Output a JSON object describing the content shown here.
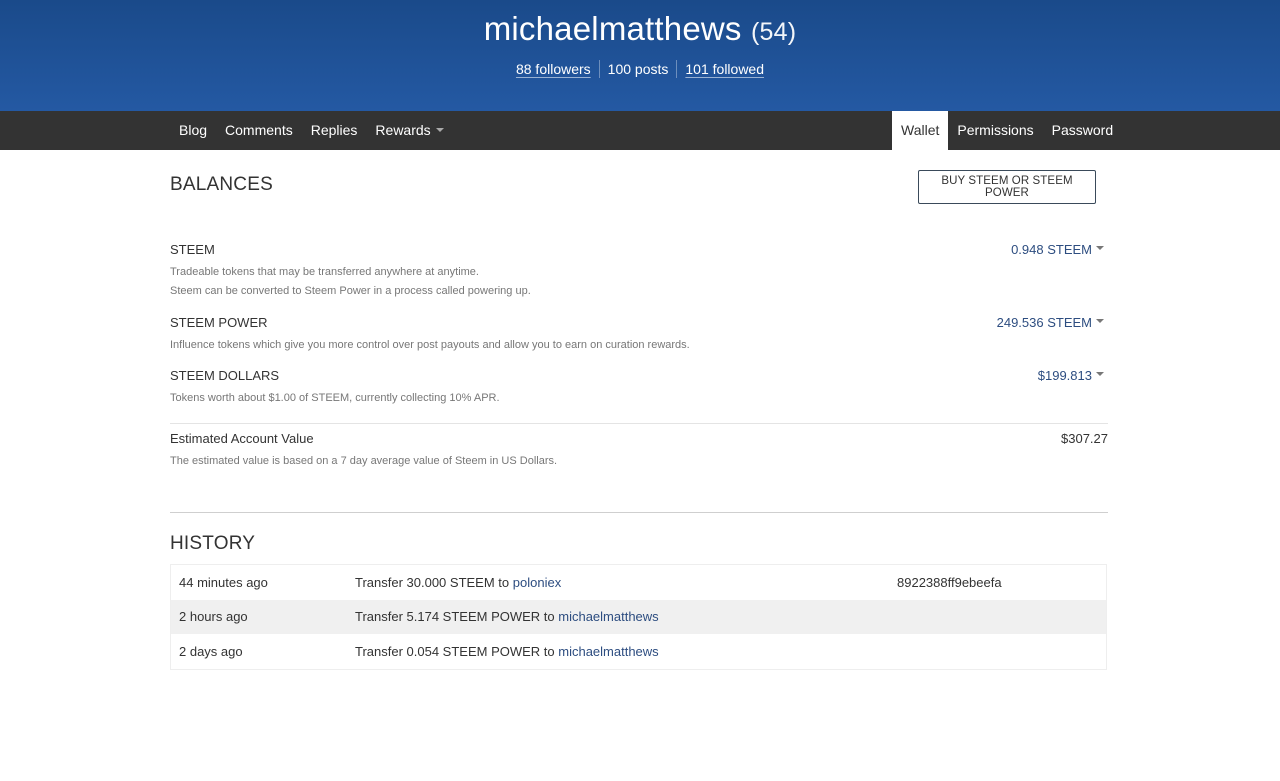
{
  "profile": {
    "username": "michaelmatthews",
    "reputation": "(54)",
    "followers": "88 followers",
    "posts": "100 posts",
    "followed": "101 followed"
  },
  "nav": {
    "left": [
      "Blog",
      "Comments",
      "Replies",
      "Rewards"
    ],
    "right": [
      "Wallet",
      "Permissions",
      "Password"
    ],
    "active": "Wallet"
  },
  "balances": {
    "title": "BALANCES",
    "buy_button": "BUY STEEM OR STEEM POWER",
    "items": [
      {
        "name": "STEEM",
        "desc1": "Tradeable tokens that may be transferred anywhere at anytime.",
        "desc2": "Steem can be converted to Steem Power in a process called powering up.",
        "value": "0.948 STEEM"
      },
      {
        "name": "STEEM POWER",
        "desc1": "Influence tokens which give you more control over post payouts and allow you to earn on curation rewards.",
        "value": "249.536 STEEM"
      },
      {
        "name": "STEEM DOLLARS",
        "desc1": "Tokens worth about $1.00 of STEEM, currently collecting 10% APR.",
        "value": "$199.813"
      }
    ],
    "estimated": {
      "name": "Estimated Account Value",
      "desc": "The estimated value is based on a 7 day average value of Steem in US Dollars.",
      "value": "$307.27"
    }
  },
  "history": {
    "title": "HISTORY",
    "rows": [
      {
        "time": "44 minutes ago",
        "prefix": "Transfer 30.000 STEEM to ",
        "account": "poloniex",
        "memo": "8922388ff9ebeefa"
      },
      {
        "time": "2 hours ago",
        "prefix": "Transfer 5.174 STEEM POWER to ",
        "account": "michaelmatthews",
        "memo": ""
      },
      {
        "time": "2 days ago",
        "prefix": "Transfer 0.054 STEEM POWER to ",
        "account": "michaelmatthews",
        "memo": ""
      }
    ]
  },
  "colors": {
    "banner": "#2459a3",
    "navbar": "#333333",
    "link": "#2d4d80"
  }
}
